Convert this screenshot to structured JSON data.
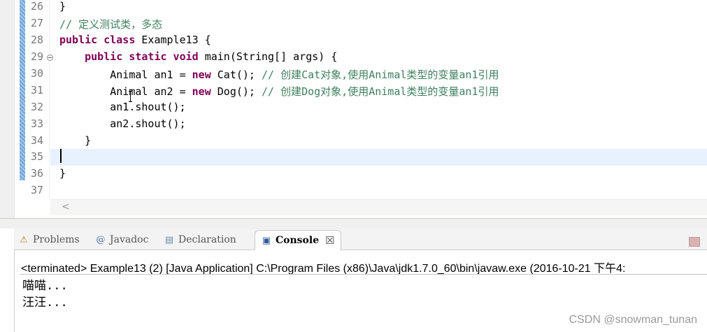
{
  "editor": {
    "lines": [
      {
        "num": "26",
        "segments": [
          {
            "t": "}",
            "c": "plain"
          }
        ]
      },
      {
        "num": "27",
        "segments": [
          {
            "t": "// 定义测试类，多态",
            "c": "comment"
          }
        ]
      },
      {
        "num": "28",
        "segments": [
          {
            "t": "public class",
            "c": "keyword"
          },
          {
            "t": " Example13 {",
            "c": "plain"
          }
        ]
      },
      {
        "num": "29",
        "fold": true,
        "segments": [
          {
            "t": "    ",
            "c": "plain"
          },
          {
            "t": "public static void",
            "c": "keyword"
          },
          {
            "t": " main(String[] args) {",
            "c": "plain"
          }
        ]
      },
      {
        "num": "30",
        "segments": [
          {
            "t": "        Animal an1 = ",
            "c": "plain"
          },
          {
            "t": "new",
            "c": "keyword"
          },
          {
            "t": " Cat(); ",
            "c": "plain"
          },
          {
            "t": "// 创建Cat对象,使用Animal类型的变量an1引用",
            "c": "comment"
          }
        ]
      },
      {
        "num": "31",
        "segments": [
          {
            "t": "        Animal an2 = ",
            "c": "plain"
          },
          {
            "t": "new",
            "c": "keyword"
          },
          {
            "t": " Dog(); ",
            "c": "plain"
          },
          {
            "t": "// 创建Dog对象,使用Animal类型的变量an1引用",
            "c": "comment"
          }
        ]
      },
      {
        "num": "32",
        "segments": [
          {
            "t": "        an1.shout();",
            "c": "plain"
          }
        ]
      },
      {
        "num": "33",
        "segments": [
          {
            "t": "        an2.shout();",
            "c": "plain"
          }
        ]
      },
      {
        "num": "34",
        "segments": [
          {
            "t": "    }",
            "c": "plain"
          }
        ]
      },
      {
        "num": "35",
        "current": true,
        "segments": []
      },
      {
        "num": "36",
        "segments": [
          {
            "t": "}",
            "c": "plain"
          }
        ]
      },
      {
        "num": "37",
        "segments": []
      }
    ],
    "fold_icon": "fold-collapse-icon",
    "scroll_left_glyph": "<"
  },
  "panel": {
    "tabs": [
      {
        "label": "Problems",
        "icon": "problems-icon",
        "glyph": "⚠"
      },
      {
        "label": "Javadoc",
        "icon": "javadoc-icon",
        "glyph": "@"
      },
      {
        "label": "Declaration",
        "icon": "declaration-icon",
        "glyph": "▤"
      },
      {
        "label": "Console",
        "icon": "console-icon",
        "glyph": "▣",
        "active": true
      }
    ],
    "close_glyph": "☒",
    "console_status": "<terminated> Example13 (2) [Java Application] C:\\Program Files (x86)\\Java\\jdk1.7.0_60\\bin\\javaw.exe (2016-10-21 下午4:",
    "output": [
      "喵喵...",
      "汪汪..."
    ]
  },
  "watermark": "CSDN @snowman_tunan",
  "colors": {
    "keyword": "#7f0055",
    "comment": "#3f7f5f",
    "current_line": "#e8f2fe",
    "gutter_marker": "#6ea3d8"
  }
}
